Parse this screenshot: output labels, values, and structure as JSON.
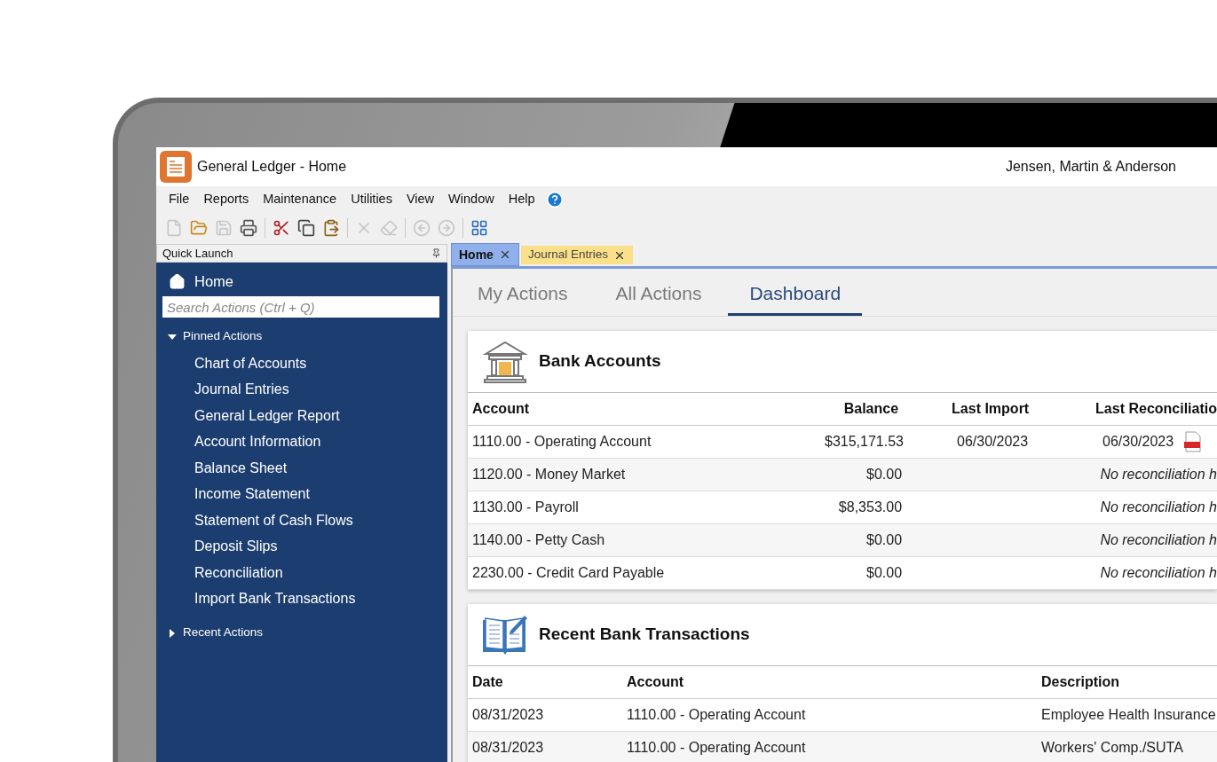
{
  "window": {
    "title": "General Ledger - Home",
    "company": "Jensen, Martin & Anderson"
  },
  "menu": [
    "File",
    "Reports",
    "Maintenance",
    "Utilities",
    "View",
    "Window",
    "Help"
  ],
  "toolbar_groups": [
    [
      {
        "kind": "new",
        "disabled": true
      },
      {
        "kind": "open",
        "disabled": false
      },
      {
        "kind": "save",
        "disabled": true
      },
      {
        "kind": "print",
        "disabled": false
      }
    ],
    [
      {
        "kind": "cut",
        "disabled": false
      },
      {
        "kind": "copy",
        "disabled": false
      },
      {
        "kind": "paste",
        "disabled": false
      }
    ],
    [
      {
        "kind": "delete",
        "disabled": true
      },
      {
        "kind": "clear",
        "disabled": true
      }
    ],
    [
      {
        "kind": "back",
        "disabled": true
      },
      {
        "kind": "forward",
        "disabled": true
      }
    ],
    [
      {
        "kind": "grid",
        "disabled": false
      }
    ]
  ],
  "sidebar": {
    "header": "Quick Launch",
    "home": "Home",
    "search": {
      "placeholder": "Search Actions (Ctrl + Q)"
    },
    "groups": [
      {
        "label": "Pinned Actions",
        "expanded": true,
        "children": [
          "Chart of Accounts",
          "Journal Entries",
          "General Ledger Report",
          "Account Information",
          "Balance Sheet",
          "Income Statement",
          "Statement of Cash Flows",
          "Deposit Slips",
          "Reconciliation",
          "Import Bank Transactions"
        ]
      },
      {
        "label": "Recent Actions",
        "expanded": false
      }
    ]
  },
  "doc_tabs": [
    {
      "label": "Home",
      "selected": true
    },
    {
      "label": "Journal Entries",
      "selected": false
    }
  ],
  "view_tabs": [
    {
      "label": "My Actions",
      "selected": false
    },
    {
      "label": "All Actions",
      "selected": false
    },
    {
      "label": "Dashboard",
      "selected": true
    }
  ],
  "bank_accounts": {
    "title": "Bank Accounts",
    "columns": [
      "Account",
      "Balance",
      "Last Import",
      "Last Reconciliatio"
    ],
    "rows": [
      {
        "account": "1110.00 - Operating Account",
        "balance": "$315,171.53",
        "last_import": "06/30/2023",
        "last_reconciliation": "06/30/2023",
        "reconciled": true
      },
      {
        "account": "1120.00 - Money Market",
        "balance": "$0.00",
        "last_import": "",
        "last_reconciliation": "No reconciliation h",
        "reconciled": false
      },
      {
        "account": "1130.00 - Payroll",
        "balance": "$8,353.00",
        "last_import": "",
        "last_reconciliation": "No reconciliation h",
        "reconciled": false
      },
      {
        "account": "1140.00 - Petty Cash",
        "balance": "$0.00",
        "last_import": "",
        "last_reconciliation": "No reconciliation h",
        "reconciled": false
      },
      {
        "account": "2230.00 - Credit Card Payable",
        "balance": "$0.00",
        "last_import": "",
        "last_reconciliation": "No reconciliation h",
        "reconciled": false
      }
    ]
  },
  "recent_transactions": {
    "title": "Recent Bank Transactions",
    "columns": [
      "Date",
      "Account",
      "Description"
    ],
    "rows": [
      {
        "date": "08/31/2023",
        "account": "1110.00 - Operating Account",
        "description": "Employee Health Insurance"
      },
      {
        "date": "08/31/2023",
        "account": "1110.00 - Operating Account",
        "description": "Workers' Comp./SUTA"
      }
    ]
  }
}
